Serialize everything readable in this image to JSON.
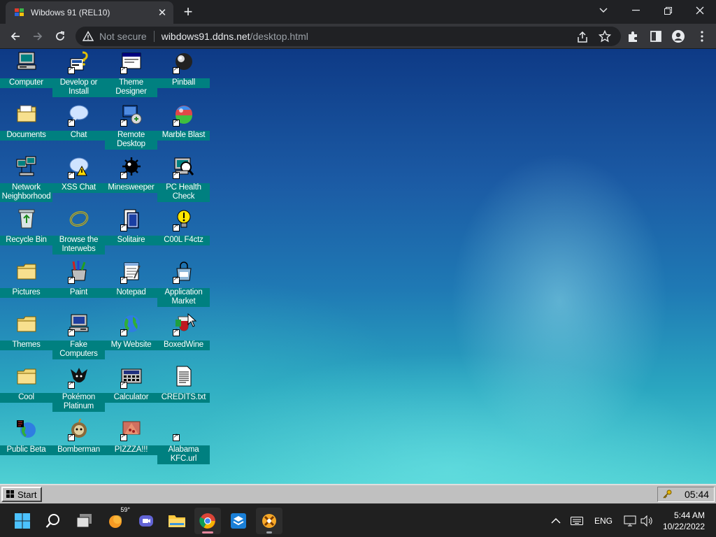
{
  "browser": {
    "tab_title": "Wibdows 91 (REL10)",
    "tab_close": "✕",
    "new_tab": "+",
    "security_label": "Not secure",
    "url_host": "wibdows91.ddns.net",
    "url_path": "/desktop.html"
  },
  "desktop": {
    "icons": [
      {
        "label": "Computer",
        "icon": "computer-icon",
        "shortcut": false
      },
      {
        "label": "Develop or Install",
        "icon": "develop-install-icon",
        "shortcut": true
      },
      {
        "label": "Theme Designer",
        "icon": "theme-designer-icon",
        "shortcut": true
      },
      {
        "label": "Pinball",
        "icon": "pinball-icon",
        "shortcut": true
      },
      {
        "label": "Documents",
        "icon": "documents-folder-icon",
        "shortcut": false
      },
      {
        "label": "Chat",
        "icon": "chat-bubble-icon",
        "shortcut": true
      },
      {
        "label": "Remote Desktop",
        "icon": "remote-desktop-icon",
        "shortcut": true
      },
      {
        "label": "Marble Blast",
        "icon": "marble-blast-icon",
        "shortcut": true
      },
      {
        "label": "Network Neighborhood",
        "icon": "network-neighborhood-icon",
        "shortcut": false
      },
      {
        "label": "XSS Chat",
        "icon": "xss-chat-icon",
        "shortcut": true
      },
      {
        "label": "Minesweeper",
        "icon": "minesweeper-icon",
        "shortcut": true
      },
      {
        "label": "PC Health Check",
        "icon": "pc-health-check-icon",
        "shortcut": true
      },
      {
        "label": "Recycle Bin",
        "icon": "recycle-bin-icon",
        "shortcut": false
      },
      {
        "label": "Browse the Interwebs",
        "icon": "browser-icon",
        "shortcut": false
      },
      {
        "label": "Solitaire",
        "icon": "solitaire-icon",
        "shortcut": true
      },
      {
        "label": "C00L F4ctz",
        "icon": "cool-facts-icon",
        "shortcut": true
      },
      {
        "label": "Pictures",
        "icon": "pictures-folder-icon",
        "shortcut": false
      },
      {
        "label": "Paint",
        "icon": "paint-icon",
        "shortcut": true
      },
      {
        "label": "Notepad",
        "icon": "notepad-icon",
        "shortcut": true
      },
      {
        "label": "Application Market",
        "icon": "application-market-icon",
        "shortcut": true
      },
      {
        "label": "Themes",
        "icon": "themes-folder-icon",
        "shortcut": false
      },
      {
        "label": "Fake Computers",
        "icon": "fake-computers-icon",
        "shortcut": true
      },
      {
        "label": "My Website",
        "icon": "globe-icon",
        "shortcut": true
      },
      {
        "label": "BoxedWine",
        "icon": "boxedwine-icon",
        "shortcut": true
      },
      {
        "label": "Cool",
        "icon": "cool-folder-icon",
        "shortcut": false
      },
      {
        "label": "Pokémon Platinum",
        "icon": "pokemon-icon",
        "shortcut": true
      },
      {
        "label": "Calculator",
        "icon": "calculator-icon",
        "shortcut": true
      },
      {
        "label": "CREDITS.txt",
        "icon": "text-file-icon",
        "shortcut": false
      },
      {
        "label": "Public Beta",
        "icon": "public-beta-icon",
        "shortcut": false
      },
      {
        "label": "Bomberman",
        "icon": "bomberman-icon",
        "shortcut": true
      },
      {
        "label": "PIZZZA!!!",
        "icon": "pizza-icon",
        "shortcut": true
      },
      {
        "label": "Alabama KFC.url",
        "icon": "url-shortcut-icon",
        "shortcut": true
      }
    ]
  },
  "w91_taskbar": {
    "start_label": "Start",
    "clock": "05:44"
  },
  "windows_taskbar": {
    "weather_temp": "59°",
    "lang": "ENG",
    "time": "5:44 AM",
    "date": "10/22/2022"
  }
}
